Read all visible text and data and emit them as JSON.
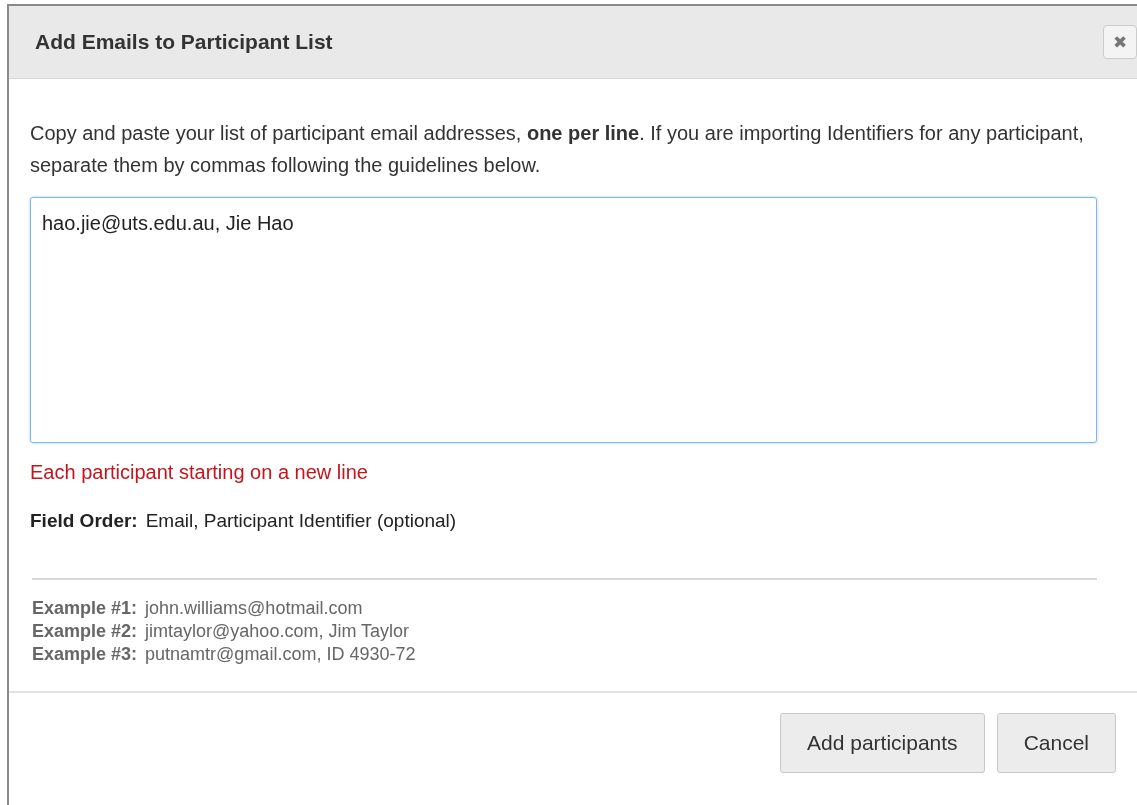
{
  "dialog": {
    "title": "Add Emails to Participant List",
    "close_label": "✖",
    "instructions": "Copy and paste your list of participant email addresses, **one per line**. If you are importing Identifiers for any participant, separate them by commas following the guidelines below.",
    "textarea": {
      "value": "hao.jie@uts.edu.au, Jie Hao",
      "focused": true
    },
    "error": "Each participant starting on a new line",
    "field_order": {
      "label": "Field Order:",
      "value": "Email, Participant Identifier (optional)"
    },
    "examples": [
      {
        "label": "Example #1:",
        "value": "john.williams@hotmail.com"
      },
      {
        "label": "Example #2:",
        "value": "jimtaylor@yahoo.com, Jim Taylor"
      },
      {
        "label": "Example #3:",
        "value": "putnamtr@gmail.com, ID 4930-72"
      }
    ],
    "buttons": [
      "Add participants",
      "Cancel"
    ]
  }
}
